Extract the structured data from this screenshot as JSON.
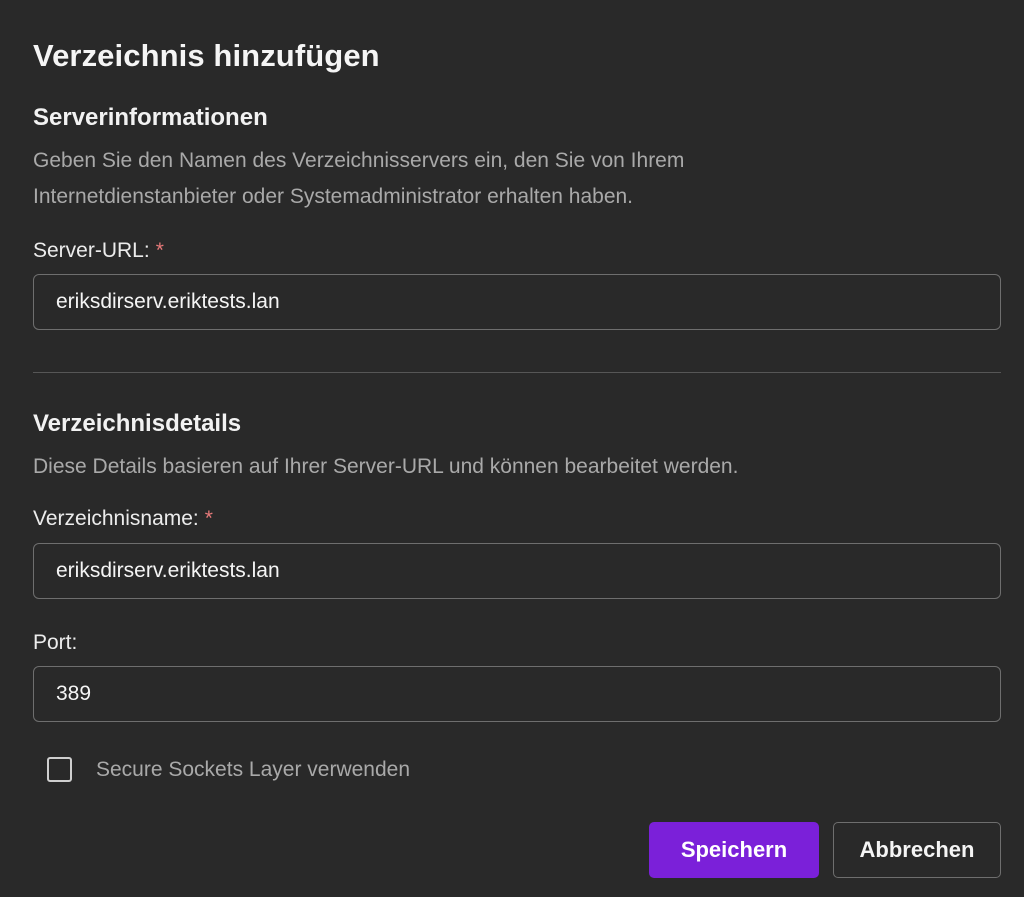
{
  "dialog": {
    "title": "Verzeichnis hinzufügen"
  },
  "server_info": {
    "heading": "Serverinformationen",
    "description_line1": "Geben Sie den Namen des Verzeichnisservers ein, den Sie von Ihrem",
    "description_line2": "Internetdienstanbieter oder Systemadministrator erhalten haben.",
    "server_url_label": "Server-URL:",
    "required_mark": "*",
    "server_url_value": "eriksdirserv.eriktests.lan"
  },
  "directory_details": {
    "heading": "Verzeichnisdetails",
    "description": "Diese Details basieren auf Ihrer Server-URL und können bearbeitet werden.",
    "name_label": "Verzeichnisname:",
    "required_mark": "*",
    "name_value": "eriksdirserv.eriktests.lan",
    "port_label": "Port:",
    "port_value": "389",
    "ssl_label": "Secure Sockets Layer verwenden",
    "ssl_checked": false
  },
  "buttons": {
    "save_label": "Speichern",
    "cancel_label": "Abbrechen"
  },
  "colors": {
    "background": "#292929",
    "accent": "#7b20d9",
    "required": "#e87a7a",
    "muted_text": "#a9a9a9"
  }
}
